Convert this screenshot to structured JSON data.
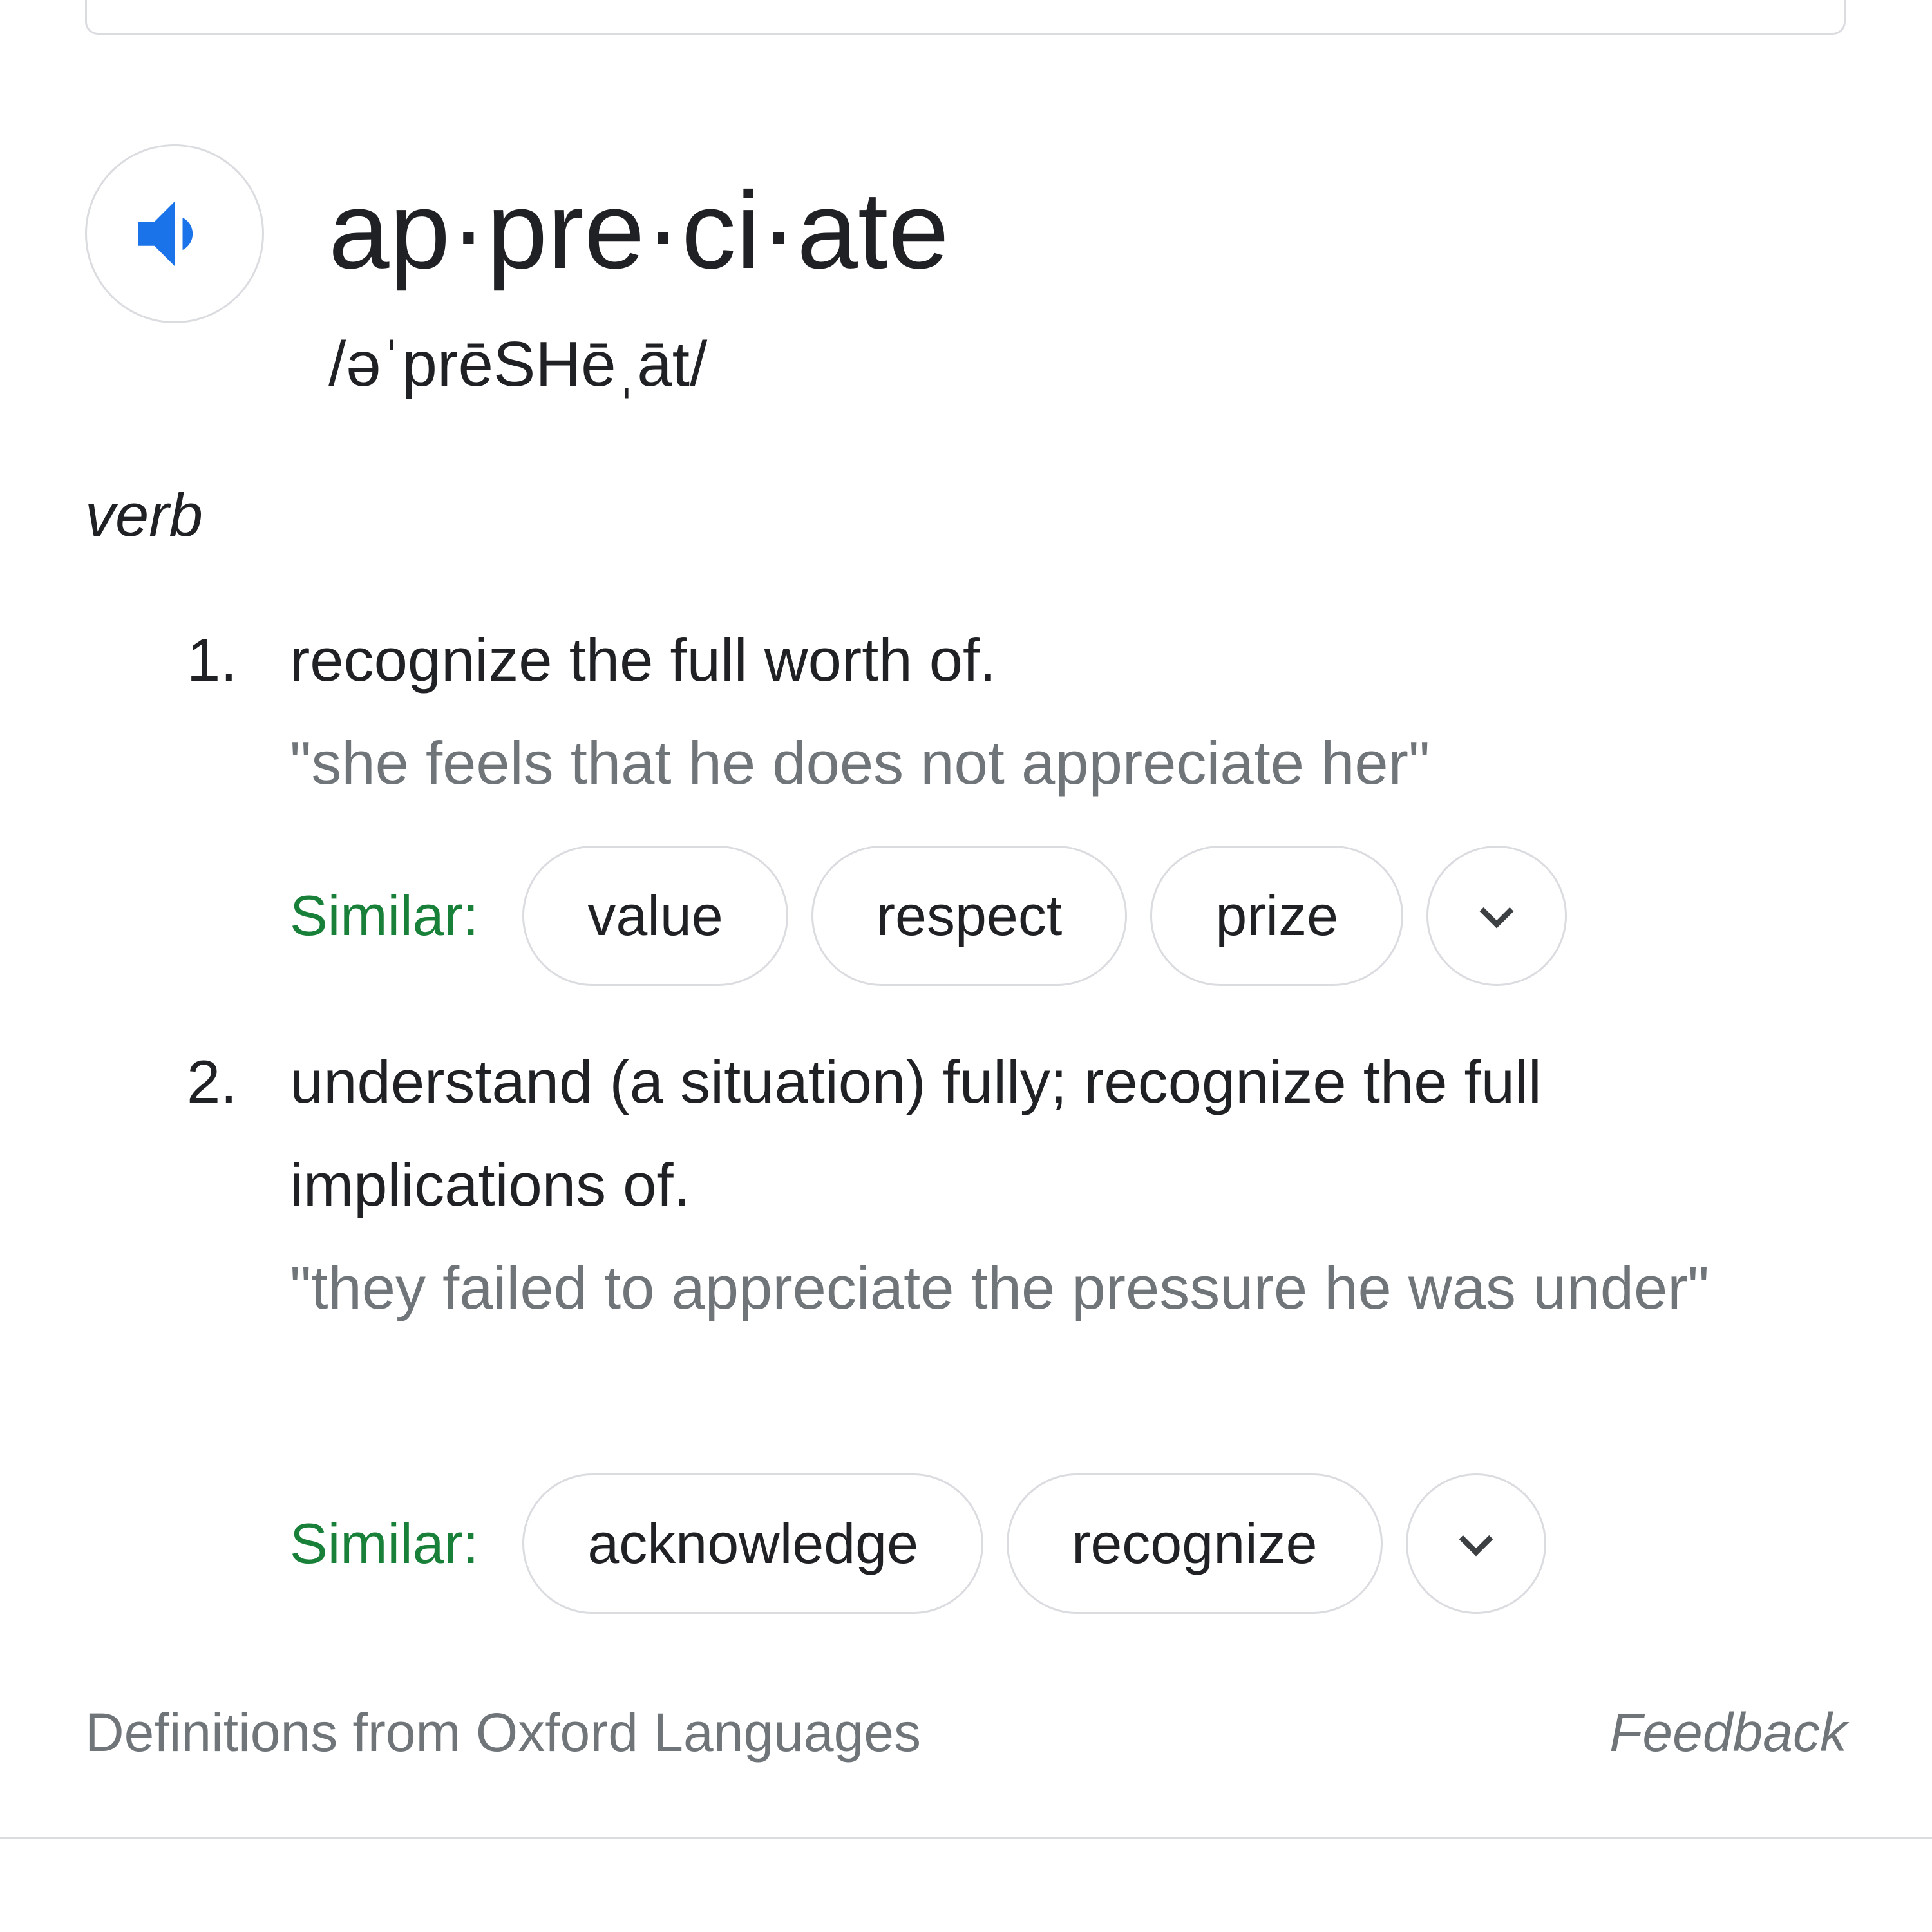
{
  "entry": {
    "headword": "ap·pre·ci·ate",
    "phonetic": "/əˈprēSHēˌāt/",
    "part_of_speech": "verb",
    "speaker_icon": "volume-up-icon"
  },
  "senses": [
    {
      "number": "1.",
      "definition": "recognize the full worth of.",
      "example": "\"she feels that he does not appreciate her\"",
      "similar_label": "Similar:",
      "similar": [
        "value",
        "respect",
        "prize"
      ],
      "expand_icon": "chevron-down-icon"
    },
    {
      "number": "2.",
      "definition": "understand (a situation) fully; recognize the full implications of.",
      "example": "\"they failed to appreciate the pressure he was under\"",
      "similar_label": "Similar:",
      "similar": [
        "acknowledge",
        "recognize"
      ],
      "expand_icon": "chevron-down-icon"
    }
  ],
  "footer": {
    "source": "Definitions from Oxford Languages",
    "feedback": "Feedback"
  },
  "colors": {
    "accent_blue": "#1a73e8",
    "similar_green": "#188038",
    "example_gray": "#70757a",
    "border_gray": "#dadce0"
  }
}
